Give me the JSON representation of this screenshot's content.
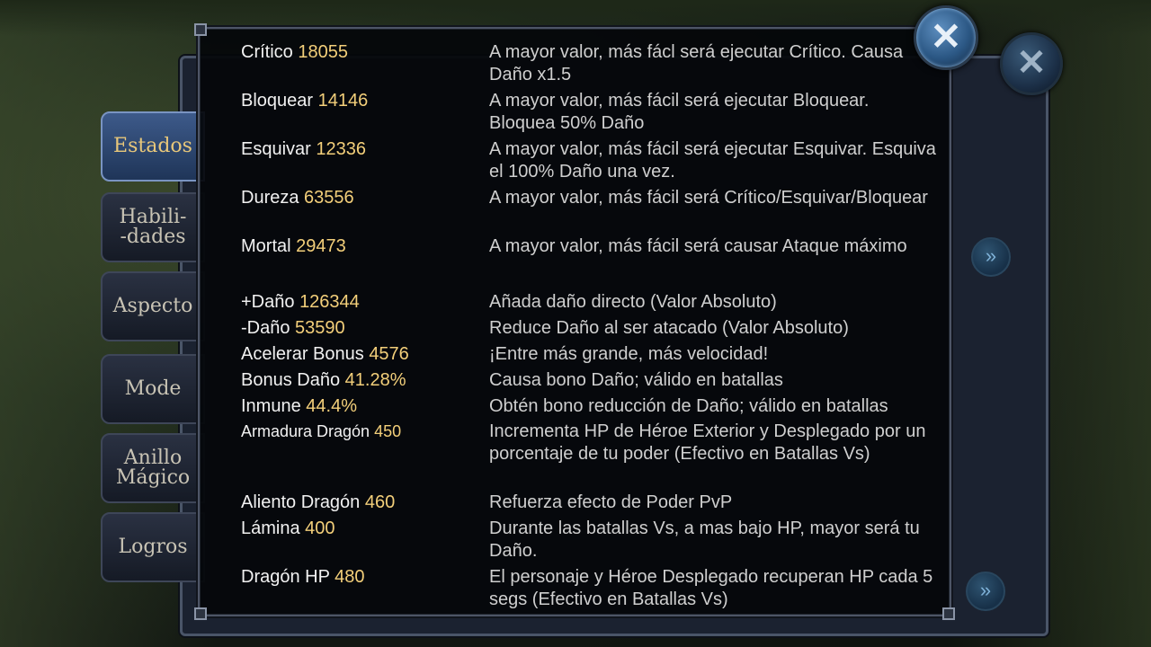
{
  "colors": {
    "label": "#f1f1f1",
    "value": "#f3cf7a",
    "description": "#cfcfcf",
    "active_tab": "#e8c77a"
  },
  "side_tabs": [
    {
      "label": "Estados",
      "active": true
    },
    {
      "label": "Habili-\n-dades",
      "active": false
    },
    {
      "label": "Aspecto",
      "active": false
    },
    {
      "label": "Mode",
      "active": false
    },
    {
      "label": "Anillo\nMágico",
      "active": false
    },
    {
      "label": "Logros",
      "active": false
    }
  ],
  "close_icon": "close-x-icon",
  "arrow_icon": "double-chevron-right-icon",
  "stats": [
    {
      "name": "Crítico",
      "value": "18055",
      "description": "A mayor valor, más fácl será ejecutar Crítico. Causa Daño x1.5"
    },
    {
      "name": "Bloquear",
      "value": "14146",
      "description": "A mayor valor, más fácil será ejecutar Bloquear. Bloquea 50% Daño"
    },
    {
      "name": "Esquivar",
      "value": "12336",
      "description": "A mayor valor, más fácil será ejecutar Esquivar. Esquiva el 100% Daño una vez."
    },
    {
      "name": "Dureza",
      "value": "63556",
      "description": "A mayor valor, más fácil será Crítico/Esquivar/Bloquear"
    },
    {
      "name": "Mortal",
      "value": "29473",
      "description": "A mayor valor, más fácil será causar Ataque máximo"
    },
    {
      "name": "+Daño",
      "value": "126344",
      "description": "Añada daño directo (Valor Absoluto)"
    },
    {
      "name": "-Daño",
      "value": "53590",
      "description": "Reduce Daño al ser atacado (Valor Absoluto)"
    },
    {
      "name": "Acelerar Bonus",
      "value": "4576",
      "description": "¡Entre más grande, más velocidad!"
    },
    {
      "name": "Bonus Daño",
      "value": "41.28%",
      "description": "Causa bono Daño; válido en batallas"
    },
    {
      "name": "Inmune",
      "value": "44.4%",
      "description": "Obtén bono reducción de Daño; válido en batallas"
    },
    {
      "name": "Armadura Dragón",
      "value": "450",
      "description": "Incrementa HP de Héroe Exterior y Desplegado por un porcentaje de tu poder (Efectivo en Batallas Vs)"
    },
    {
      "name": "Aliento Dragón",
      "value": "460",
      "description": "Refuerza efecto de Poder PvP"
    },
    {
      "name": "Lámina",
      "value": "400",
      "description": "Durante las batallas Vs, a mas bajo HP, mayor será tu Daño."
    },
    {
      "name": "Dragón HP",
      "value": "480",
      "description": "El personaje y Héroe Desplegado recuperan HP cada 5 segs (Efectivo en Batallas Vs)"
    }
  ]
}
